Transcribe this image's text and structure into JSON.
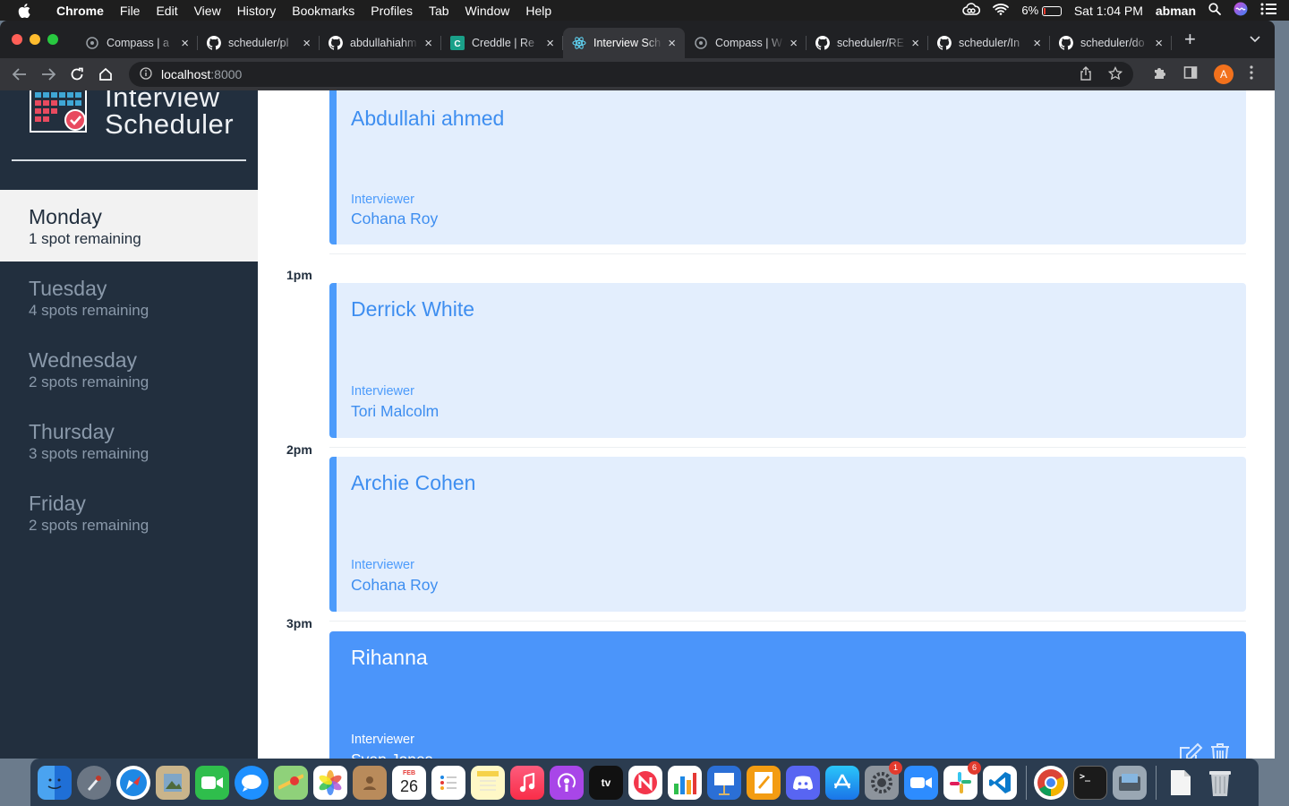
{
  "menubar": {
    "app": "Chrome",
    "items": [
      "File",
      "Edit",
      "View",
      "History",
      "Bookmarks",
      "Profiles",
      "Tab",
      "Window",
      "Help"
    ],
    "battery": "6%",
    "clock": "Sat 1:04 PM",
    "user": "abman"
  },
  "tabs": [
    {
      "title": "Compass | a",
      "icon": "compass-icon"
    },
    {
      "title": "scheduler/pl",
      "icon": "github-icon"
    },
    {
      "title": "abdullahiahm",
      "icon": "github-icon"
    },
    {
      "title": "Creddle | Re",
      "icon": "creddle-icon"
    },
    {
      "title": "Interview Sch",
      "icon": "react-icon"
    },
    {
      "title": "Compass | W",
      "icon": "compass-icon"
    },
    {
      "title": "scheduler/RE",
      "icon": "github-icon"
    },
    {
      "title": "scheduler/In",
      "icon": "github-icon"
    },
    {
      "title": "scheduler/do",
      "icon": "github-icon"
    }
  ],
  "address": {
    "host": "localhost",
    "port": ":8000"
  },
  "profile_initial": "A",
  "app": {
    "logo_line1": "Interview",
    "logo_line2": "Scheduler",
    "days": [
      {
        "name": "Monday",
        "spots": "1 spot remaining"
      },
      {
        "name": "Tuesday",
        "spots": "4 spots remaining"
      },
      {
        "name": "Wednesday",
        "spots": "2 spots remaining"
      },
      {
        "name": "Thursday",
        "spots": "3 spots remaining"
      },
      {
        "name": "Friday",
        "spots": "2 spots remaining"
      }
    ],
    "times": [
      "1pm",
      "2pm",
      "3pm"
    ],
    "appointments": [
      {
        "student": "Abdullahi ahmed",
        "interviewer_label": "Interviewer",
        "interviewer": "Cohana Roy"
      },
      {
        "student": "Derrick White",
        "interviewer_label": "Interviewer",
        "interviewer": "Tori Malcolm"
      },
      {
        "student": "Archie Cohen",
        "interviewer_label": "Interviewer",
        "interviewer": "Cohana Roy"
      },
      {
        "student": "Rihanna",
        "interviewer_label": "Interviewer",
        "interviewer": "Sven Jones"
      }
    ]
  },
  "dock": {
    "calendar_month": "FEB",
    "calendar_day": "26",
    "facetime_badge": "1",
    "slack_badge": "6"
  },
  "colors": {
    "sidebar": "#222f3e",
    "accent": "#4c9bfb",
    "slot_bg": "#e3eefd"
  }
}
